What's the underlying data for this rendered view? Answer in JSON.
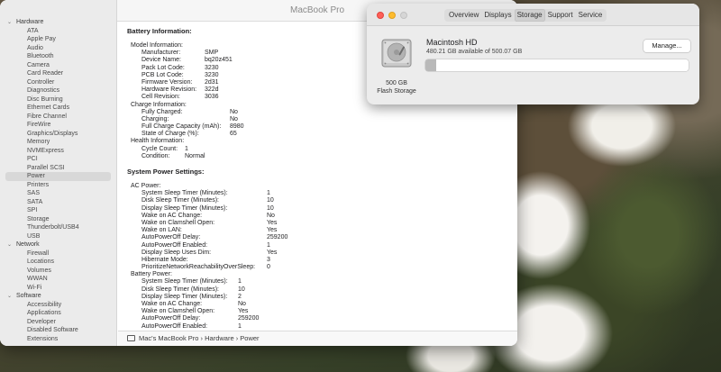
{
  "main_window": {
    "title": "MacBook Pro",
    "sidebar": [
      {
        "header": "Hardware",
        "items": [
          "ATA",
          "Apple Pay",
          "Audio",
          "Bluetooth",
          "Camera",
          "Card Reader",
          "Controller",
          "Diagnostics",
          "Disc Burning",
          "Ethernet Cards",
          "Fibre Channel",
          "FireWire",
          "Graphics/Displays",
          "Memory",
          "NVMExpress",
          "PCI",
          "Parallel SCSI",
          "Power",
          "Printers",
          "SAS",
          "SATA",
          "SPI",
          "Storage",
          "Thunderbolt/USB4",
          "USB"
        ]
      },
      {
        "header": "Network",
        "items": [
          "Firewall",
          "Locations",
          "Volumes",
          "WWAN",
          "Wi-Fi"
        ]
      },
      {
        "header": "Software",
        "items": [
          "Accessibility",
          "Applications",
          "Developer",
          "Disabled Software",
          "Extensions"
        ]
      }
    ],
    "selected_item": "Power",
    "battery": {
      "title": "Battery Information:",
      "model_header": "Model Information:",
      "model": [
        {
          "k": "Manufacturer:",
          "v": "SMP"
        },
        {
          "k": "Device Name:",
          "v": "bq20z451"
        },
        {
          "k": "Pack Lot Code:",
          "v": "3230"
        },
        {
          "k": "PCB Lot Code:",
          "v": "3230"
        },
        {
          "k": "Firmware Version:",
          "v": "2d31"
        },
        {
          "k": "Hardware Revision:",
          "v": "322d"
        },
        {
          "k": "Cell Revision:",
          "v": "3036"
        }
      ],
      "charge_header": "Charge Information:",
      "charge": [
        {
          "k": "Fully Charged:",
          "v": "No"
        },
        {
          "k": "Charging:",
          "v": "No"
        },
        {
          "k": "Full Charge Capacity (mAh):",
          "v": "8980"
        },
        {
          "k": "State of Charge (%):",
          "v": "65"
        }
      ],
      "health_header": "Health Information:",
      "health": [
        {
          "k": "Cycle Count:",
          "v": "1"
        },
        {
          "k": "Condition:",
          "v": "Normal"
        }
      ]
    },
    "power_settings": {
      "title": "System Power Settings:",
      "ac_header": "AC Power:",
      "ac": [
        {
          "k": "System Sleep Timer (Minutes):",
          "v": "1"
        },
        {
          "k": "Disk Sleep Timer (Minutes):",
          "v": "10"
        },
        {
          "k": "Display Sleep Timer (Minutes):",
          "v": "10"
        },
        {
          "k": "Wake on AC Change:",
          "v": "No"
        },
        {
          "k": "Wake on Clamshell Open:",
          "v": "Yes"
        },
        {
          "k": "Wake on LAN:",
          "v": "Yes"
        },
        {
          "k": "AutoPowerOff Delay:",
          "v": "259200"
        },
        {
          "k": "AutoPowerOff Enabled:",
          "v": "1"
        },
        {
          "k": "Display Sleep Uses Dim:",
          "v": "Yes"
        },
        {
          "k": "Hibernate Mode:",
          "v": "3"
        },
        {
          "k": "PrioritizeNetworkReachabilityOverSleep:",
          "v": "0"
        }
      ],
      "battery_header": "Battery Power:",
      "battery": [
        {
          "k": "System Sleep Timer (Minutes):",
          "v": "1"
        },
        {
          "k": "Disk Sleep Timer (Minutes):",
          "v": "10"
        },
        {
          "k": "Display Sleep Timer (Minutes):",
          "v": "2"
        },
        {
          "k": "Wake on AC Change:",
          "v": "No"
        },
        {
          "k": "Wake on Clamshell Open:",
          "v": "Yes"
        },
        {
          "k": "AutoPowerOff Delay:",
          "v": "259200"
        },
        {
          "k": "AutoPowerOff Enabled:",
          "v": "1"
        }
      ]
    },
    "breadcrumb": "Mac's MacBook Pro › Hardware › Power"
  },
  "about_window": {
    "tabs": [
      "Overview",
      "Displays",
      "Storage",
      "Support",
      "Service"
    ],
    "active_tab": "Storage",
    "disk": {
      "name": "Macintosh HD",
      "available": "480.21 GB available of 500.07 GB",
      "size": "500 GB",
      "type": "Flash Storage",
      "used_fraction": 0.04
    },
    "manage_label": "Manage..."
  }
}
